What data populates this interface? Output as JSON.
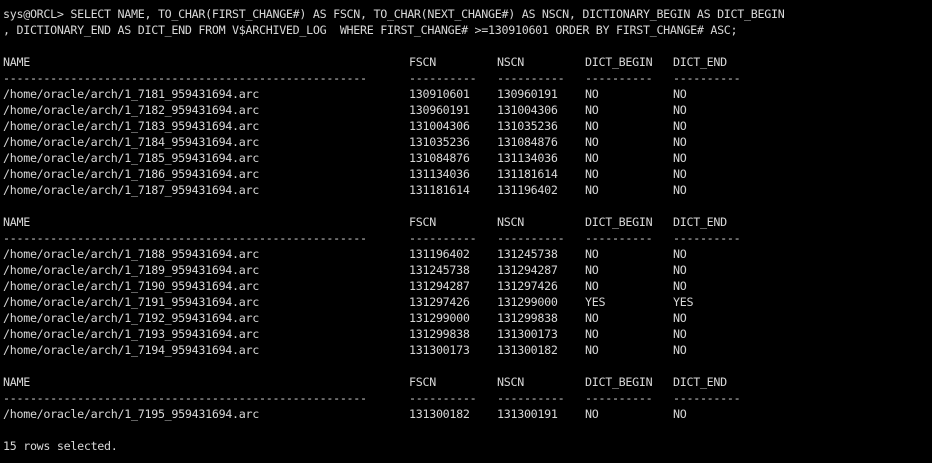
{
  "terminal": {
    "command_line_1": "sys@ORCL> SELECT NAME, TO_CHAR(FIRST_CHANGE#) AS FSCN, TO_CHAR(NEXT_CHANGE#) AS NSCN, DICTIONARY_BEGIN AS DICT_BEGIN",
    "command_line_2": ", DICTIONARY_END AS DICT_END FROM V$ARCHIVED_LOG  WHERE FIRST_CHANGE# >=130910601 ORDER BY FIRST_CHANGE# ASC;",
    "headers": {
      "name": "NAME",
      "fscn": "FSCN",
      "nscn": "NSCN",
      "dict_begin": "DICT_BEGIN",
      "dict_end": "DICT_END"
    },
    "separators": {
      "name": "------------------------------------------------------",
      "fscn": "----------",
      "nscn": "----------",
      "dict_begin": "----------",
      "dict_end": "----------"
    },
    "groups": [
      {
        "rows": [
          {
            "name": "/home/oracle/arch/1_7181_959431694.arc",
            "fscn": "130910601",
            "nscn": "130960191",
            "dict_begin": "NO",
            "dict_end": "NO"
          },
          {
            "name": "/home/oracle/arch/1_7182_959431694.arc",
            "fscn": "130960191",
            "nscn": "131004306",
            "dict_begin": "NO",
            "dict_end": "NO"
          },
          {
            "name": "/home/oracle/arch/1_7183_959431694.arc",
            "fscn": "131004306",
            "nscn": "131035236",
            "dict_begin": "NO",
            "dict_end": "NO"
          },
          {
            "name": "/home/oracle/arch/1_7184_959431694.arc",
            "fscn": "131035236",
            "nscn": "131084876",
            "dict_begin": "NO",
            "dict_end": "NO"
          },
          {
            "name": "/home/oracle/arch/1_7185_959431694.arc",
            "fscn": "131084876",
            "nscn": "131134036",
            "dict_begin": "NO",
            "dict_end": "NO"
          },
          {
            "name": "/home/oracle/arch/1_7186_959431694.arc",
            "fscn": "131134036",
            "nscn": "131181614",
            "dict_begin": "NO",
            "dict_end": "NO"
          },
          {
            "name": "/home/oracle/arch/1_7187_959431694.arc",
            "fscn": "131181614",
            "nscn": "131196402",
            "dict_begin": "NO",
            "dict_end": "NO"
          }
        ]
      },
      {
        "rows": [
          {
            "name": "/home/oracle/arch/1_7188_959431694.arc",
            "fscn": "131196402",
            "nscn": "131245738",
            "dict_begin": "NO",
            "dict_end": "NO"
          },
          {
            "name": "/home/oracle/arch/1_7189_959431694.arc",
            "fscn": "131245738",
            "nscn": "131294287",
            "dict_begin": "NO",
            "dict_end": "NO"
          },
          {
            "name": "/home/oracle/arch/1_7190_959431694.arc",
            "fscn": "131294287",
            "nscn": "131297426",
            "dict_begin": "NO",
            "dict_end": "NO"
          },
          {
            "name": "/home/oracle/arch/1_7191_959431694.arc",
            "fscn": "131297426",
            "nscn": "131299000",
            "dict_begin": "YES",
            "dict_end": "YES"
          },
          {
            "name": "/home/oracle/arch/1_7192_959431694.arc",
            "fscn": "131299000",
            "nscn": "131299838",
            "dict_begin": "NO",
            "dict_end": "NO"
          },
          {
            "name": "/home/oracle/arch/1_7193_959431694.arc",
            "fscn": "131299838",
            "nscn": "131300173",
            "dict_begin": "NO",
            "dict_end": "NO"
          },
          {
            "name": "/home/oracle/arch/1_7194_959431694.arc",
            "fscn": "131300173",
            "nscn": "131300182",
            "dict_begin": "NO",
            "dict_end": "NO"
          }
        ]
      },
      {
        "rows": [
          {
            "name": "/home/oracle/arch/1_7195_959431694.arc",
            "fscn": "131300182",
            "nscn": "131300191",
            "dict_begin": "NO",
            "dict_end": "NO"
          }
        ]
      }
    ],
    "footer": "15 rows selected.",
    "colors": {
      "background": "#000000",
      "foreground": "#d8d8d8"
    }
  }
}
